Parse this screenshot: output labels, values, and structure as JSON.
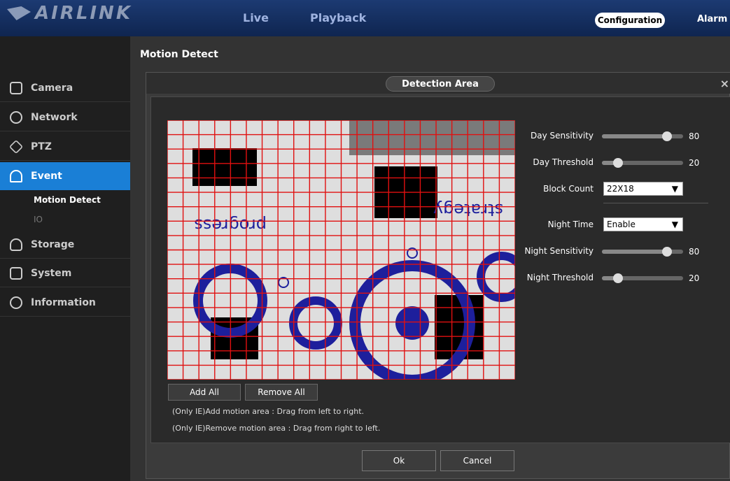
{
  "header": {
    "brand": "AIRLINK",
    "nav": [
      "Live",
      "Playback"
    ],
    "configuration": "Configuration",
    "alarm": "Alarm"
  },
  "sidebar": {
    "items": [
      {
        "label": "Camera",
        "icon": "camera-icon"
      },
      {
        "label": "Network",
        "icon": "network-icon"
      },
      {
        "label": "PTZ",
        "icon": "ptz-icon"
      },
      {
        "label": "Event",
        "icon": "alarm-icon"
      },
      {
        "label": "Storage",
        "icon": "storage-icon"
      },
      {
        "label": "System",
        "icon": "system-icon"
      },
      {
        "label": "Information",
        "icon": "info-icon"
      }
    ],
    "subitems": [
      "Motion Detect",
      "IO"
    ]
  },
  "page": {
    "title": "Motion Detect"
  },
  "dialog": {
    "title": "Detection Area",
    "close": "×",
    "add_all": "Add All",
    "remove_all": "Remove All",
    "hint_add": "(Only IE)Add motion area : Drag from left to right.",
    "hint_remove": "(Only IE)Remove motion area : Drag from right to left.",
    "ok": "Ok",
    "cancel": "Cancel",
    "grid": {
      "cols": 22,
      "rows": 18,
      "color": "#e01010"
    },
    "controls": {
      "day_sensitivity": {
        "label": "Day Sensitivity",
        "value": "80",
        "level": 0.8
      },
      "day_threshold": {
        "label": "Day Threshold",
        "value": "20",
        "level": 0.2
      },
      "block_count": {
        "label": "Block Count",
        "value": "22X18"
      },
      "night_time": {
        "label": "Night Time",
        "value": "Enable"
      },
      "night_sensitivity": {
        "label": "Night Sensitivity",
        "value": "80",
        "level": 0.8
      },
      "night_threshold": {
        "label": "Night Threshold",
        "value": "20",
        "level": 0.2
      }
    }
  },
  "colors": {
    "accent": "#1a7fd6",
    "header": "#12306a"
  }
}
